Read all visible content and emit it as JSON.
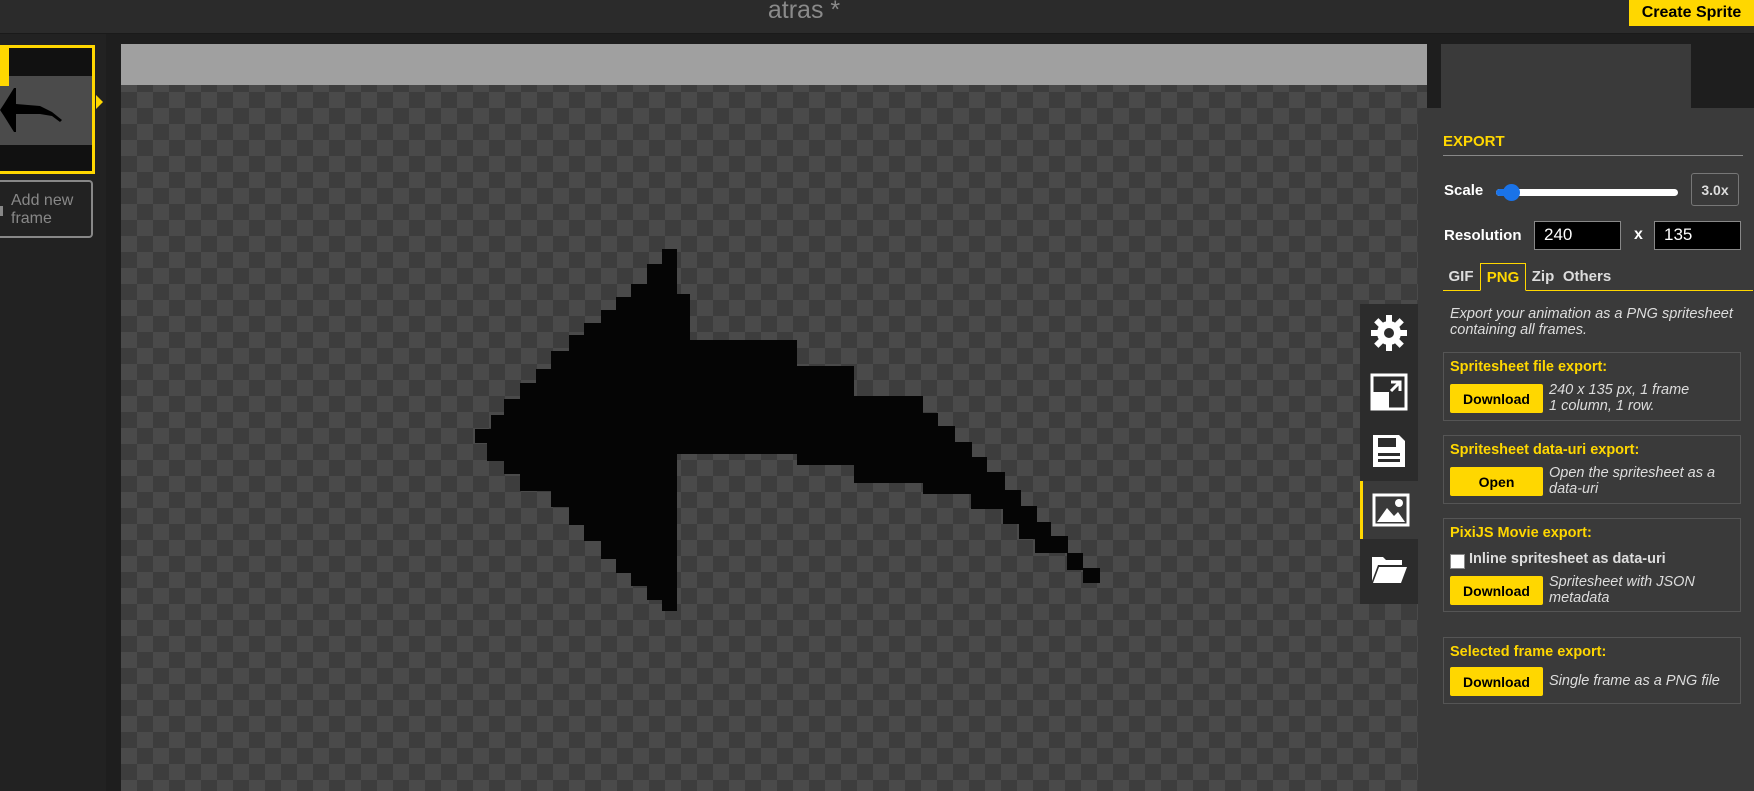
{
  "header": {
    "title": "atras *",
    "create_sprite": "Create Sprite"
  },
  "frames": {
    "add_new_line1": "Add new",
    "add_new_line2": "frame"
  },
  "tools": [
    {
      "name": "settings",
      "icon": "gear-icon"
    },
    {
      "name": "resize",
      "icon": "resize-icon"
    },
    {
      "name": "save",
      "icon": "floppy-disk-icon"
    },
    {
      "name": "export",
      "icon": "image-icon",
      "active": true
    },
    {
      "name": "import",
      "icon": "folder-open-icon"
    }
  ],
  "export": {
    "heading": "EXPORT",
    "scale_label": "Scale",
    "scale_value": "3.0x",
    "resolution_label": "Resolution",
    "width": "240",
    "height": "135",
    "x_sep": "x",
    "tabs": [
      "GIF",
      "PNG",
      "Zip",
      "Others"
    ],
    "active_tab": "PNG",
    "description": "Export your animation as a PNG spritesheet containing all frames.",
    "spritesheet_file": {
      "title": "Spritesheet file export:",
      "button": "Download",
      "note_line1": "240 x 135 px, 1 frame",
      "note_line2": "1 column, 1 row."
    },
    "data_uri": {
      "title": "Spritesheet data-uri export:",
      "button": "Open",
      "note": "Open the spritesheet as a data-uri"
    },
    "pixijs": {
      "title": "PixiJS Movie export:",
      "checkbox_label": "Inline spritesheet as data-uri",
      "button": "Download",
      "note": "Spritesheet with JSON metadata"
    },
    "selected_frame": {
      "title": "Selected frame export:",
      "button": "Download",
      "note": "Single frame as a PNG file"
    }
  },
  "colors": {
    "accent": "#ffd700",
    "panel": "#3a3a3a",
    "slider": "#1a73e8"
  }
}
